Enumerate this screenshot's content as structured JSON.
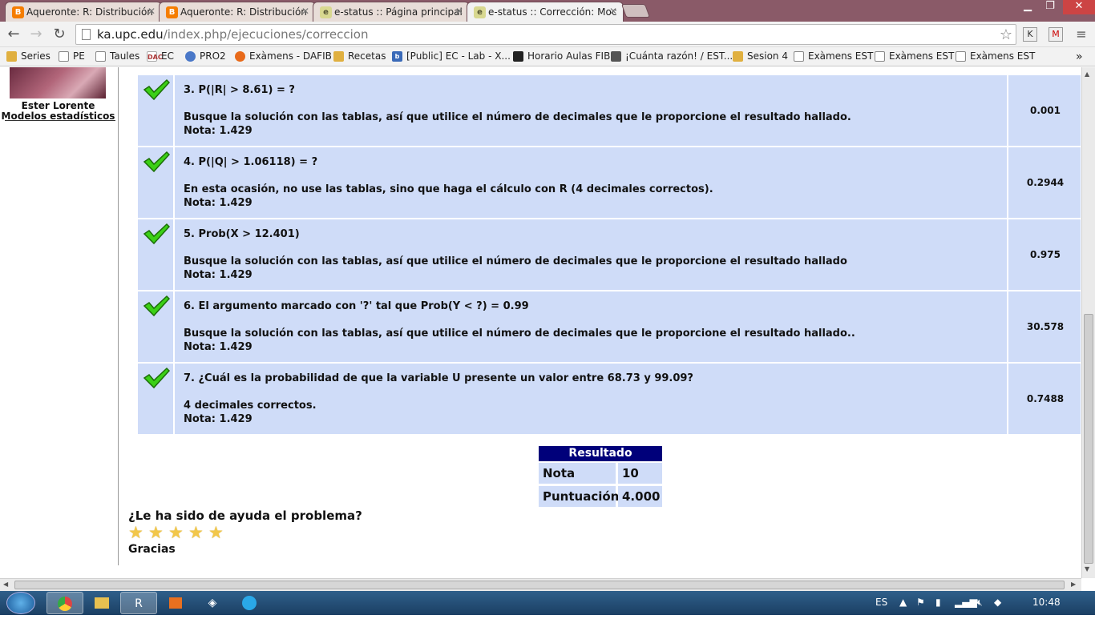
{
  "browser": {
    "tabs": [
      {
        "title": "Aqueronte: R: Distribución",
        "icon": "blogger-icon"
      },
      {
        "title": "Aqueronte: R: Distribución",
        "icon": "blogger-icon"
      },
      {
        "title": "e-status :: Página principal",
        "icon": "estatus-icon"
      },
      {
        "title": "e-status :: Corrección: Moc",
        "icon": "estatus-icon"
      }
    ],
    "url_host": "ka.upc.edu",
    "url_path": "/index.php/ejecuciones/correccion",
    "extensions": [
      "K",
      "M"
    ],
    "bookmarks": [
      {
        "label": "Series",
        "icon": "folder-icon"
      },
      {
        "label": "PE",
        "icon": "page-icon"
      },
      {
        "label": "Taules",
        "icon": "page-icon"
      },
      {
        "label": "EC",
        "icon": "dac-icon"
      },
      {
        "label": "PRO2",
        "icon": "globe-icon"
      },
      {
        "label": "Exàmens - DAFIB",
        "icon": "firefox-icon"
      },
      {
        "label": "Recetas",
        "icon": "folder-icon"
      },
      {
        "label": "[Public] EC - Lab - X...",
        "icon": "b-icon"
      },
      {
        "label": "Horario Aulas FIB",
        "icon": "bookmark-icon"
      },
      {
        "label": "¡Cuánta razón! / EST...",
        "icon": "film-icon"
      },
      {
        "label": "Sesion 4",
        "icon": "folder-icon"
      },
      {
        "label": "Exàmens EST",
        "icon": "page-icon"
      },
      {
        "label": "Exàmens EST",
        "icon": "page-icon"
      },
      {
        "label": "Exàmens EST",
        "icon": "page-icon"
      }
    ]
  },
  "sidebar": {
    "name": "Ester Lorente",
    "course": "Modelos estadísticos"
  },
  "questions": [
    {
      "title": "3. P(|R| > 8.61) = ?",
      "description": "Busque la solución con las tablas, así que utilice el número de decimales que le proporcione el resultado hallado.",
      "grade": "Nota: 1.429",
      "answer": "0.001"
    },
    {
      "title": "4. P(|Q| > 1.06118) = ?",
      "description": "En esta ocasión, no use las tablas, sino que haga el cálculo con R (4 decimales correctos).",
      "grade": "Nota: 1.429",
      "answer": "0.2944"
    },
    {
      "title": "5. Prob(X > 12.401)",
      "description": "Busque la solución con las tablas, así que utilice el número de decimales que le proporcione el resultado hallado",
      "grade": "Nota: 1.429",
      "answer": "0.975"
    },
    {
      "title": "6. El argumento marcado con '?' tal que Prob(Y < ?) = 0.99",
      "description": "Busque la solución con las tablas, así que utilice el número de decimales que le proporcione el resultado hallado..",
      "grade": "Nota: 1.429",
      "answer": "30.578"
    },
    {
      "title": "7. ¿Cuál es la probabilidad de que la variable U presente un valor entre 68.73 y 99.09?",
      "description": "4 decimales correctos.",
      "grade": "Nota: 1.429",
      "answer": "0.7488"
    }
  ],
  "result": {
    "header": "Resultado",
    "rows": [
      {
        "label": "Nota",
        "value": "10"
      },
      {
        "label": "Puntuación",
        "value": "4.000"
      }
    ]
  },
  "feedback": {
    "question": "¿Le ha sido de ayuda el problema?",
    "stars": 5,
    "thanks": "Gracias"
  },
  "taskbar": {
    "language": "ES",
    "time": "10:48"
  }
}
